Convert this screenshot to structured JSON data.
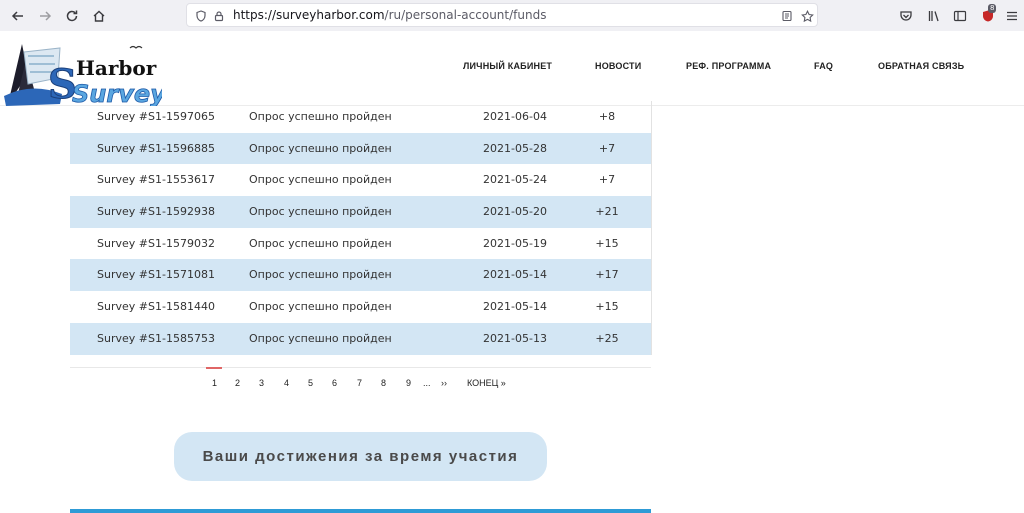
{
  "browser": {
    "url_host": "https://surveyharbor.com",
    "url_path": "/ru/personal-account/funds",
    "extension_badge": "8"
  },
  "logo": {
    "word_top": "Harbor",
    "word_bottom": "Survey",
    "initial": "S"
  },
  "nav": {
    "items": [
      "ЛИЧНЫЙ КАБИНЕТ",
      "НОВОСТИ",
      "РЕФ. ПРОГРАММА",
      "FAQ",
      "ОБРАТНАЯ СВЯЗЬ"
    ]
  },
  "table": {
    "rows": [
      {
        "id": "Survey #S1-1597065",
        "status": "Опрос успешно пройден",
        "date": "2021-06-04",
        "points": "+8"
      },
      {
        "id": "Survey #S1-1596885",
        "status": "Опрос успешно пройден",
        "date": "2021-05-28",
        "points": "+7"
      },
      {
        "id": "Survey #S1-1553617",
        "status": "Опрос успешно пройден",
        "date": "2021-05-24",
        "points": "+7"
      },
      {
        "id": "Survey #S1-1592938",
        "status": "Опрос успешно пройден",
        "date": "2021-05-20",
        "points": "+21"
      },
      {
        "id": "Survey #S1-1579032",
        "status": "Опрос успешно пройден",
        "date": "2021-05-19",
        "points": "+15"
      },
      {
        "id": "Survey #S1-1571081",
        "status": "Опрос успешно пройден",
        "date": "2021-05-14",
        "points": "+17"
      },
      {
        "id": "Survey #S1-1581440",
        "status": "Опрос успешно пройден",
        "date": "2021-05-14",
        "points": "+15"
      },
      {
        "id": "Survey #S1-1585753",
        "status": "Опрос успешно пройден",
        "date": "2021-05-13",
        "points": "+25"
      }
    ]
  },
  "pagination": {
    "pages": [
      "1",
      "2",
      "3",
      "4",
      "5",
      "6",
      "7",
      "8",
      "9"
    ],
    "ellipsis": "...",
    "next": "››",
    "last": "КОНЕЦ »",
    "active": "1"
  },
  "achievements": {
    "title": "Ваши достижения за время участия"
  }
}
